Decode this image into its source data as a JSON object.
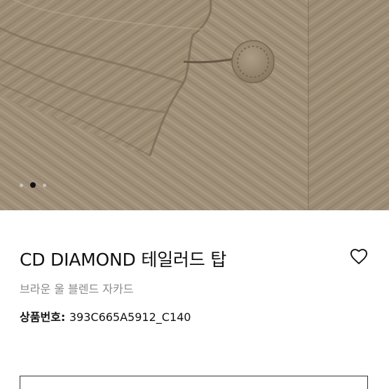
{
  "gallery": {
    "image": "beige-herringbone-jacquard-top-with-button",
    "slide_count": 3,
    "active_slide": 2
  },
  "product": {
    "title": "CD DIAMOND 테일러드 탑",
    "subtitle": "브라운 울 블렌드 자카드",
    "code_label": "상품번호: ",
    "code_value": "393C665A5912_C140",
    "wishlist_icon": "heart-outline-icon"
  },
  "colors": {
    "fabric": "#a6957e",
    "active_dot": "#111111",
    "subtitle_text": "#8a8a8a"
  }
}
